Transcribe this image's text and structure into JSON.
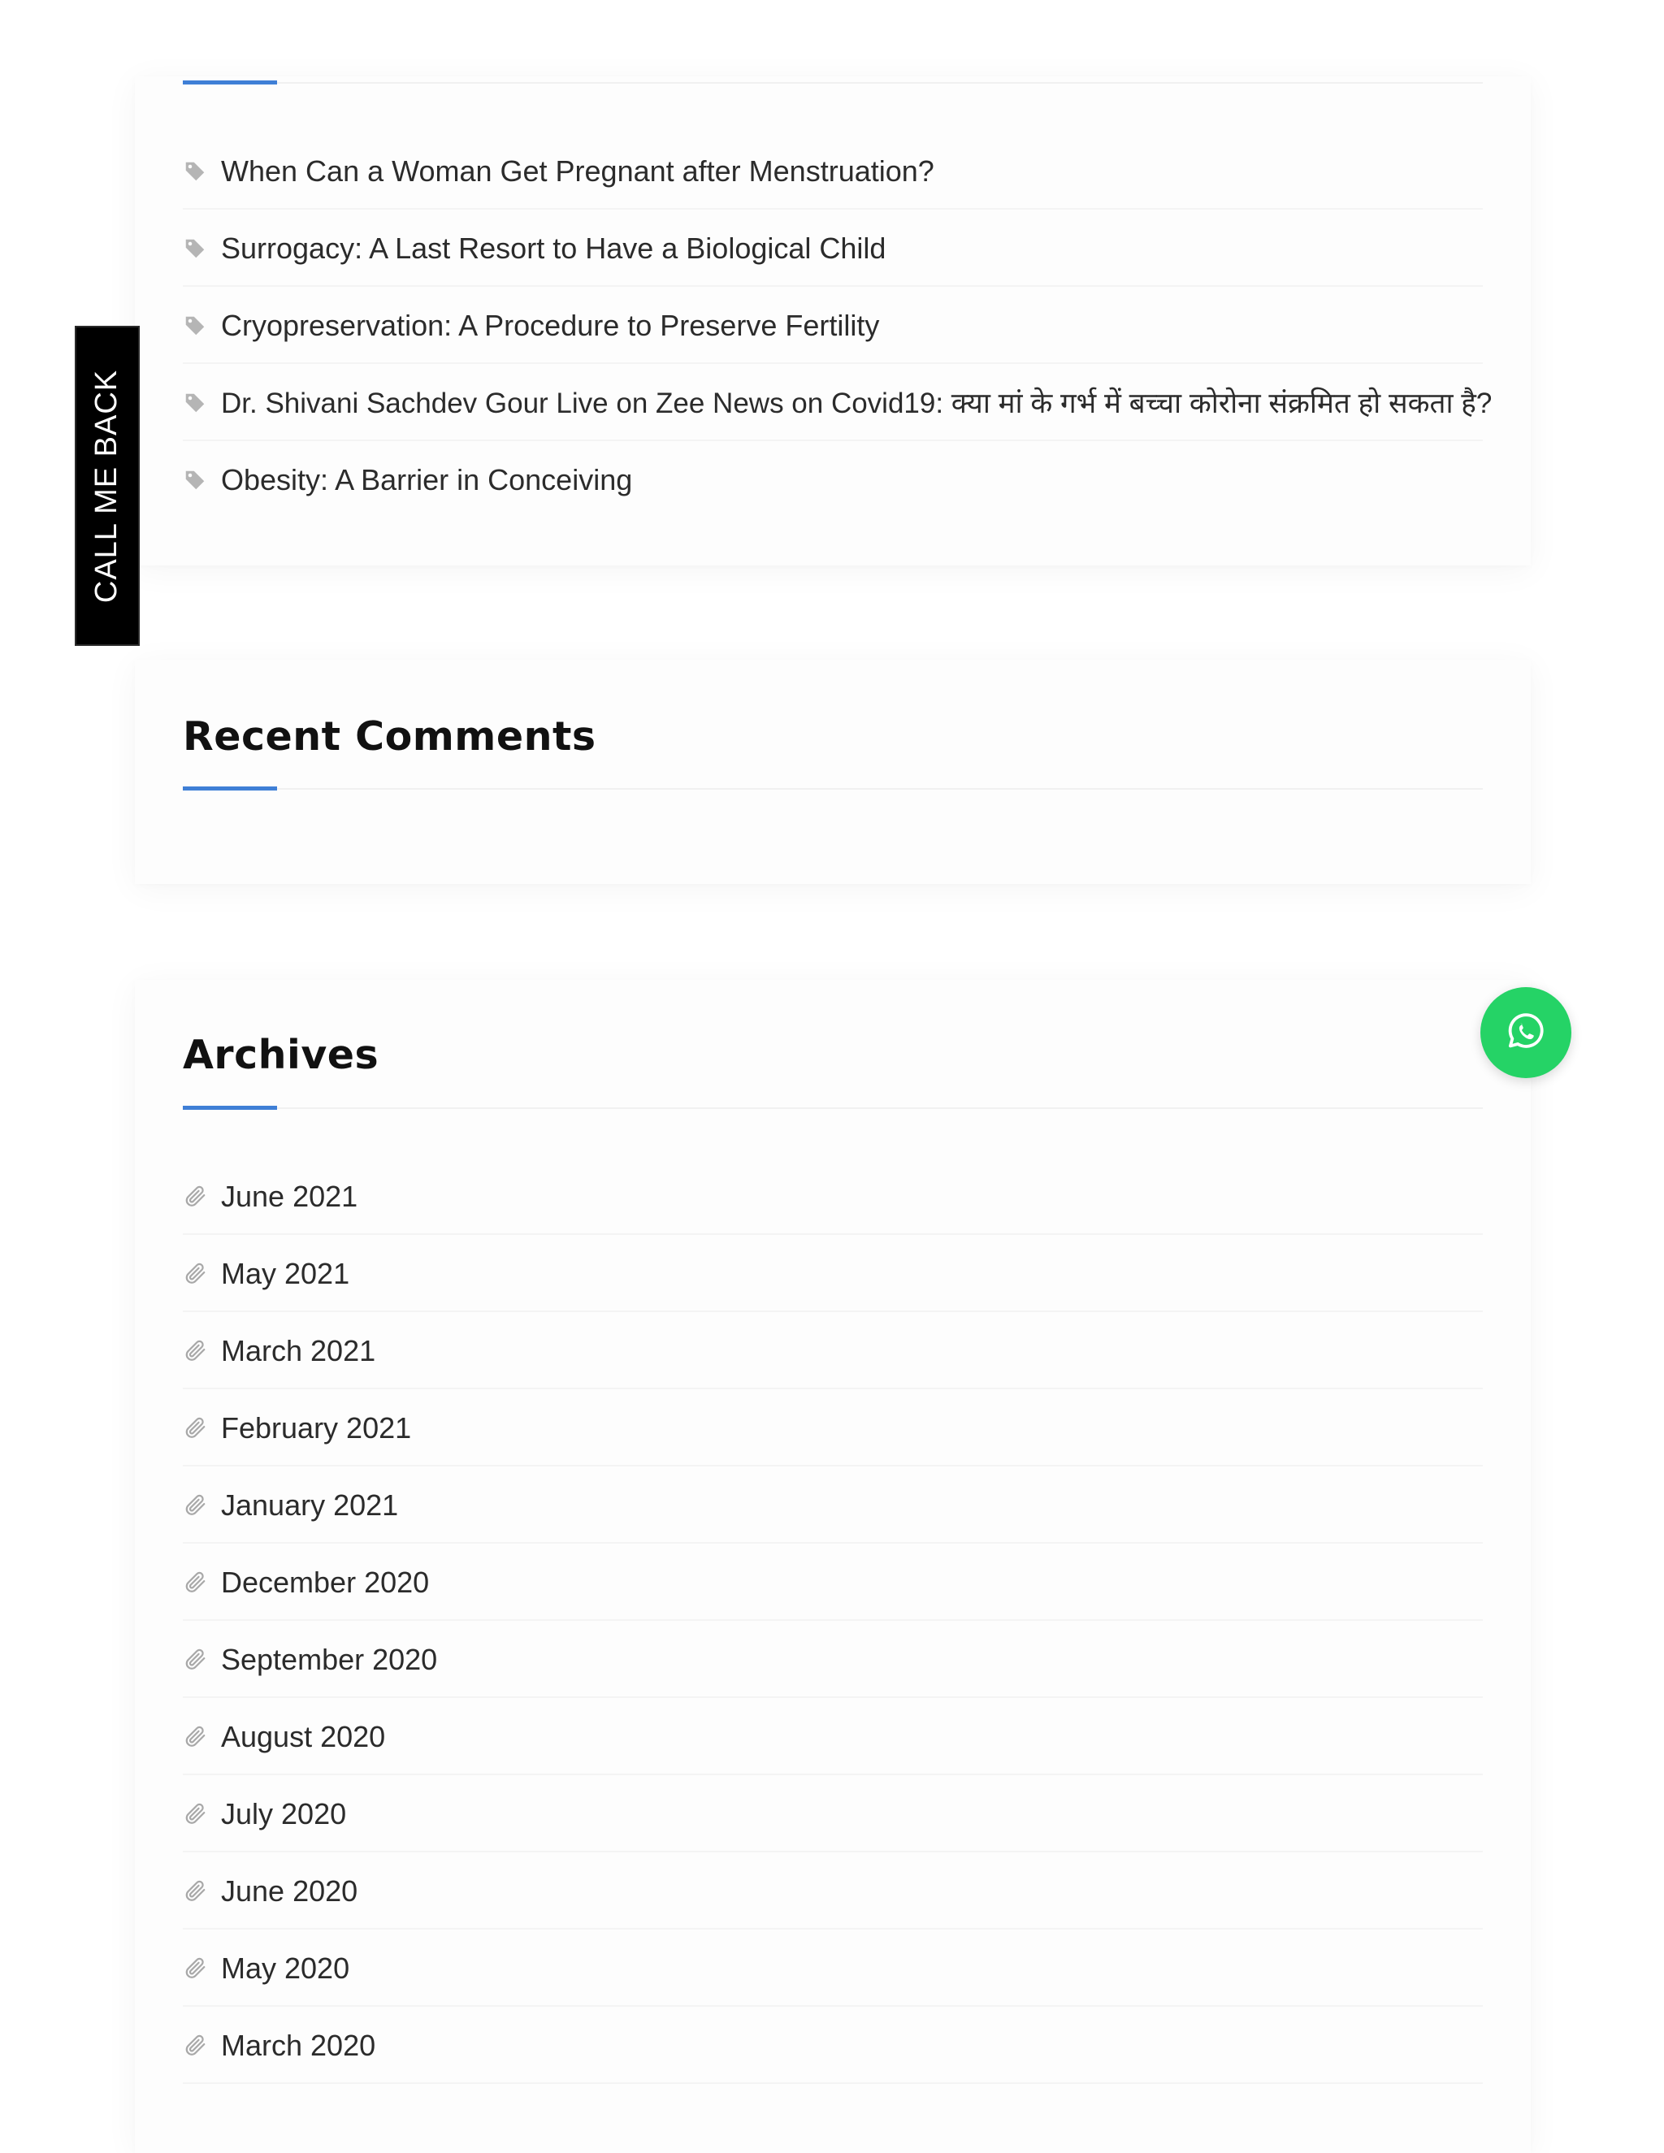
{
  "recent_posts": {
    "items": [
      {
        "label": "When Can a Woman Get Pregnant after Menstruation?",
        "icon": "tag-icon"
      },
      {
        "label": "Surrogacy: A Last Resort to Have a Biological Child",
        "icon": "tag-icon"
      },
      {
        "label": "Cryopreservation: A Procedure to Preserve Fertility",
        "icon": "tag-icon"
      },
      {
        "label": "Dr. Shivani Sachdev Gour Live on Zee News on Covid19: क्या मां के गर्भ में बच्चा कोरोना संक्रमित हो सकता है?",
        "icon": "tag-icon"
      },
      {
        "label": "Obesity: A Barrier in Conceiving",
        "icon": "tag-icon"
      }
    ]
  },
  "recent_comments": {
    "title": "Recent Comments"
  },
  "archives": {
    "title": "Archives",
    "items": [
      {
        "label": "June 2021",
        "icon": "paperclip-icon"
      },
      {
        "label": "May 2021",
        "icon": "paperclip-icon"
      },
      {
        "label": "March 2021",
        "icon": "paperclip-icon"
      },
      {
        "label": "February 2021",
        "icon": "paperclip-icon"
      },
      {
        "label": "January 2021",
        "icon": "paperclip-icon"
      },
      {
        "label": "December 2020",
        "icon": "paperclip-icon"
      },
      {
        "label": "September 2020",
        "icon": "paperclip-icon"
      },
      {
        "label": "August 2020",
        "icon": "paperclip-icon"
      },
      {
        "label": "July 2020",
        "icon": "paperclip-icon"
      },
      {
        "label": "June 2020",
        "icon": "paperclip-icon"
      },
      {
        "label": "May 2020",
        "icon": "paperclip-icon"
      },
      {
        "label": "March 2020",
        "icon": "paperclip-icon"
      }
    ]
  },
  "call_me_back": {
    "label": "CALL ME BACK"
  },
  "whatsapp": {
    "icon": "whatsapp-icon",
    "color": "#25d366"
  },
  "colors": {
    "accent": "#3f7fd6",
    "icon_gray": "#a8a8a8",
    "text": "#2b2b2b",
    "heading": "#111111"
  }
}
